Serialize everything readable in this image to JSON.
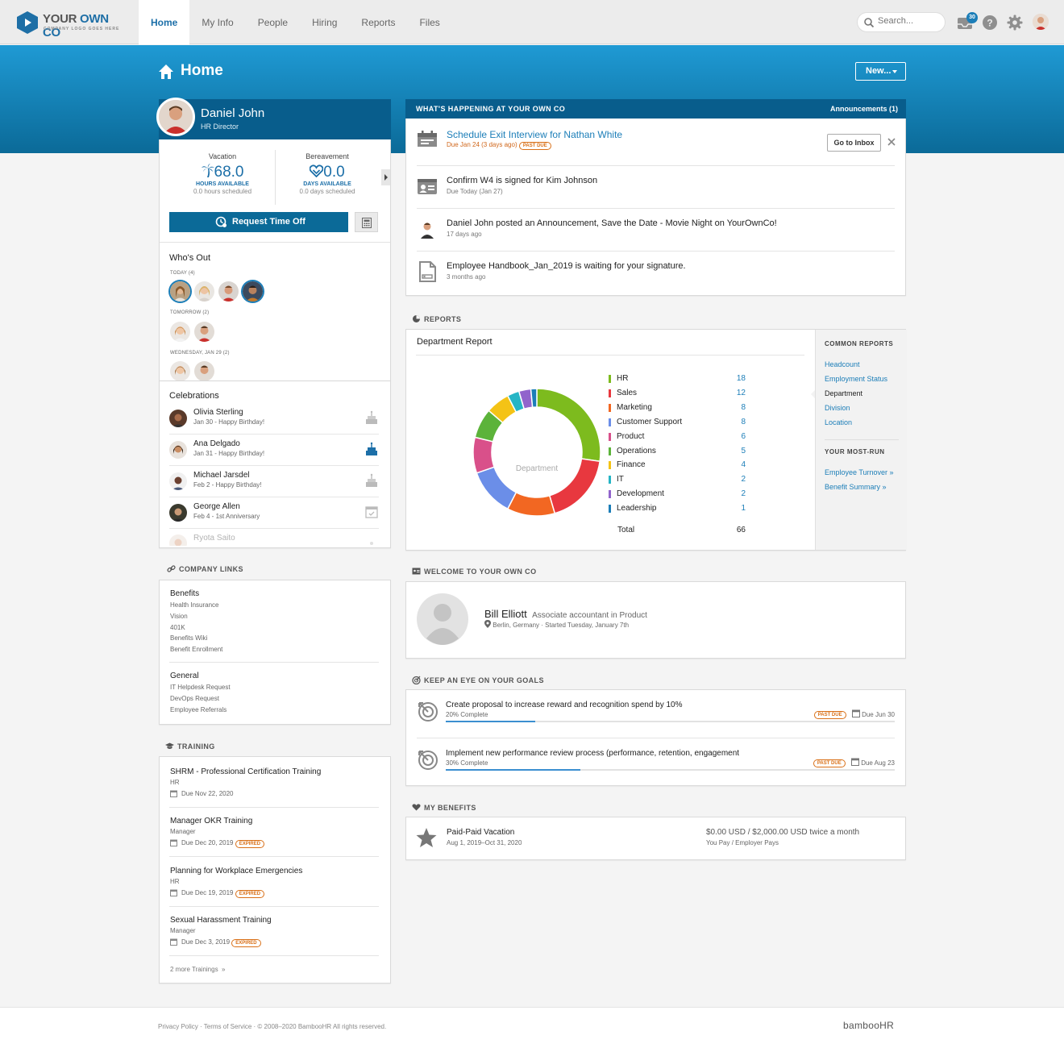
{
  "topnav": {
    "logo_name_a": "YOUR ",
    "logo_name_b": "OWN CO",
    "logo_tag": "COMPANY LOGO GOES HERE",
    "tabs": [
      "Home",
      "My Info",
      "People",
      "Hiring",
      "Reports",
      "Files"
    ],
    "active_tab": "Home",
    "search_placeholder": "Search...",
    "inbox_count": "30",
    "icons": [
      "inbox-icon",
      "help-icon",
      "gear-icon",
      "avatar"
    ]
  },
  "page": {
    "title": "Home",
    "new_button": "New..."
  },
  "profile": {
    "name": "Daniel John",
    "role": "HR Director",
    "vacation": {
      "label": "Vacation",
      "value": "68.0",
      "unit": "HOURS AVAILABLE",
      "scheduled": "0.0 hours scheduled"
    },
    "bereavement": {
      "label": "Bereavement",
      "value": "0.0",
      "unit": "DAYS AVAILABLE",
      "scheduled": "0.0 days scheduled"
    },
    "request_button": "Request Time Off"
  },
  "whos_out": {
    "title": "Who's Out",
    "today": "TODAY (4)",
    "tomorrow": "TOMORROW (2)",
    "wednesday": "WEDNESDAY, JAN 29 (2)"
  },
  "celebrations": {
    "title": "Celebrations",
    "items": [
      {
        "name": "Olivia Sterling",
        "detail": "Jan 30 - Happy Birthday!"
      },
      {
        "name": "Ana Delgado",
        "detail": "Jan 31 - Happy Birthday!"
      },
      {
        "name": "Michael Jarsdel",
        "detail": "Feb 2 - Happy Birthday!"
      },
      {
        "name": "George Allen",
        "detail": "Feb 4 - 1st Anniversary"
      },
      {
        "name": "Ryota Saito",
        "detail": ""
      }
    ]
  },
  "company_links": {
    "title": "COMPANY LINKS",
    "groups": [
      {
        "name": "Benefits",
        "items": [
          "Health Insurance",
          "Vision",
          "401K",
          "Benefits Wiki",
          "Benefit Enrollment"
        ]
      },
      {
        "name": "General",
        "items": [
          "IT Helpdesk Request",
          "DevOps Request",
          "Employee Referrals"
        ]
      }
    ]
  },
  "training": {
    "title": "TRAINING",
    "items": [
      {
        "title": "SHRM - Professional Certification Training",
        "sub": "HR",
        "due": "Due Nov 22, 2020",
        "badge": ""
      },
      {
        "title": "Manager OKR Training",
        "sub": "Manager",
        "due": "Due Dec 20, 2019",
        "badge": "EXPIRED"
      },
      {
        "title": "Planning for Workplace Emergencies",
        "sub": "HR",
        "due": "Due Dec 19, 2019",
        "badge": "EXPIRED"
      },
      {
        "title": "Sexual Harassment Training",
        "sub": "Manager",
        "due": "Due Dec 3, 2019",
        "badge": "EXPIRED"
      }
    ],
    "more": "2 more Trainings",
    "more_arrow": "»"
  },
  "happening": {
    "title": "WHAT'S HAPPENING AT YOUR OWN CO",
    "announcements": "Announcements (1)",
    "go_to_inbox": "Go to Inbox",
    "items": [
      {
        "title": "Schedule Exit Interview for Nathan White",
        "sub": "Due Jan 24 (3 days ago)",
        "badge": "PAST DUE"
      },
      {
        "title": "Confirm W4 is signed for Kim Johnson",
        "sub": "Due Today (Jan 27)"
      },
      {
        "title": "Daniel John posted an Announcement, Save the Date - Movie Night on YourOwnCo!",
        "sub": "17 days ago"
      },
      {
        "title": "Employee Handbook_Jan_2019 is waiting for your signature.",
        "sub": "3 months ago"
      }
    ]
  },
  "reports": {
    "title": "REPORTS",
    "report_title": "Department Report",
    "center_label": "Department",
    "total_label": "Total",
    "total_value": "66",
    "common_title": "COMMON REPORTS",
    "common": [
      "Headcount",
      "Employment Status",
      "Department",
      "Division",
      "Location"
    ],
    "current": "Department",
    "most_run_title": "YOUR MOST-RUN",
    "most_run": [
      "Employee Turnover »",
      "Benefit Summary »"
    ]
  },
  "chart_data": {
    "type": "pie",
    "title": "Department Report",
    "categories": [
      "HR",
      "Sales",
      "Marketing",
      "Customer Support",
      "Product",
      "Operations",
      "Finance",
      "IT",
      "Development",
      "Leadership"
    ],
    "values": [
      18,
      12,
      8,
      8,
      6,
      5,
      4,
      2,
      2,
      1
    ],
    "colors": [
      "#7dbb1e",
      "#e8383f",
      "#f26722",
      "#6b8ee8",
      "#d9508a",
      "#5cb33a",
      "#f4c316",
      "#26b5c5",
      "#9164cc",
      "#1c7eb8"
    ],
    "total": 66,
    "donut": true
  },
  "welcome": {
    "title": "WELCOME TO YOUR OWN CO",
    "name": "Bill Elliott",
    "role": "Associate accountant in Product",
    "detail": "Berlin, Germany · Started Tuesday, January 7th"
  },
  "goals": {
    "title": "KEEP AN EYE ON YOUR GOALS",
    "items": [
      {
        "title": "Create proposal to increase reward and recognition spend by 10%",
        "progress": "20% Complete",
        "percent": 20,
        "badge": "PAST DUE",
        "due": "Due Jun 30"
      },
      {
        "title": "Implement new performance review process (performance, retention, engagement",
        "progress": "30% Complete",
        "percent": 30,
        "badge": "PAST DUE",
        "due": "Due Aug 23"
      }
    ]
  },
  "benefits": {
    "title": "MY BENEFITS",
    "name": "Paid-Paid Vacation",
    "dates": "Aug 1, 2019–Oct 31, 2020",
    "amount": "$0.00 USD / $2,000.00 USD twice a month",
    "payers": "You Pay / Employer Pays"
  },
  "footer": {
    "text": "Privacy Policy  ·  Terms of Service  ·  © 2008–2020 BambooHR All rights reserved.",
    "brand": "bambooHR"
  }
}
